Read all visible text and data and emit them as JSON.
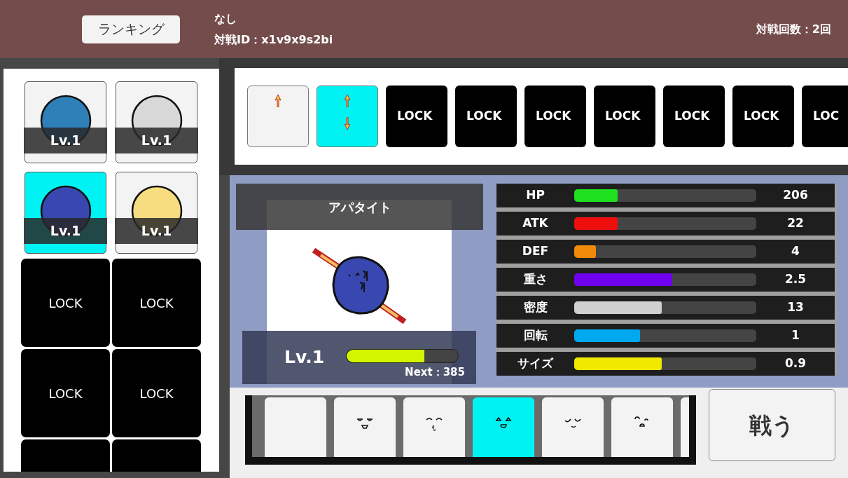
{
  "header": {
    "ranking_button": "ランキング",
    "status": "なし",
    "match_id": "対戦ID：x1v9x9s2bi",
    "match_count": "対戦回数：2回"
  },
  "stones": [
    {
      "kind": "stone",
      "color": "#2f7fb8",
      "level_label": "Lv.1",
      "selected": false
    },
    {
      "kind": "stone",
      "color": "#d8d8d8",
      "level_label": "Lv.1",
      "selected": false
    },
    {
      "kind": "stone",
      "color": "#3848b0",
      "level_label": "Lv.1",
      "selected": true
    },
    {
      "kind": "stone",
      "color": "#f8dc80",
      "level_label": "Lv.1",
      "selected": false
    },
    {
      "kind": "locked",
      "label": "LOCK",
      "selected": false
    },
    {
      "kind": "locked",
      "label": "LOCK",
      "selected": false
    },
    {
      "kind": "locked",
      "label": "LOCK",
      "selected": false
    },
    {
      "kind": "locked",
      "label": "LOCK",
      "selected": false
    },
    {
      "kind": "locked",
      "selected": false
    },
    {
      "kind": "locked",
      "selected": false
    }
  ],
  "slots": [
    {
      "kind": "single",
      "selected": false
    },
    {
      "kind": "double",
      "selected": true
    },
    {
      "kind": "locked",
      "label": "LOCK",
      "selected": false
    },
    {
      "kind": "locked",
      "label": "LOCK",
      "selected": false
    },
    {
      "kind": "locked",
      "label": "LOCK",
      "selected": false
    },
    {
      "kind": "locked",
      "label": "LOCK",
      "selected": false
    },
    {
      "kind": "locked",
      "label": "LOCK",
      "selected": false
    },
    {
      "kind": "locked",
      "label": "LOCK",
      "selected": false
    },
    {
      "kind": "locked",
      "label": "LOC",
      "selected": false
    }
  ],
  "character": {
    "name": "アパタイト",
    "level_label": "Lv.1",
    "level": 0.7,
    "next": "Next：385"
  },
  "stats": [
    {
      "label": "HP",
      "value": "206",
      "level": 0.24,
      "color": "#1ee01e"
    },
    {
      "label": "ATK",
      "value": "22",
      "level": 0.24,
      "color": "#ee0e0e"
    },
    {
      "label": "DEF",
      "value": "4",
      "level": 0.12,
      "color": "#f08a0a"
    },
    {
      "label": "重さ",
      "value": "2.5",
      "level": 0.54,
      "color": "#7000f0"
    },
    {
      "label": "密度",
      "value": "13",
      "level": 0.48,
      "color": "#d0d0d0"
    },
    {
      "label": "回転",
      "value": "1",
      "level": 0.36,
      "color": "#00a8f0"
    },
    {
      "label": "サイズ",
      "value": "0.9",
      "level": 0.48,
      "color": "#f0ea00"
    }
  ],
  "faces": [
    {
      "kind": "blank",
      "selected": false
    },
    {
      "kind": "face",
      "selected": false
    },
    {
      "kind": "face",
      "selected": false
    },
    {
      "kind": "face",
      "selected": true
    },
    {
      "kind": "face",
      "selected": false
    },
    {
      "kind": "face",
      "selected": false
    },
    {
      "kind": "blank",
      "selected": false
    }
  ],
  "fight_button": "戦う"
}
